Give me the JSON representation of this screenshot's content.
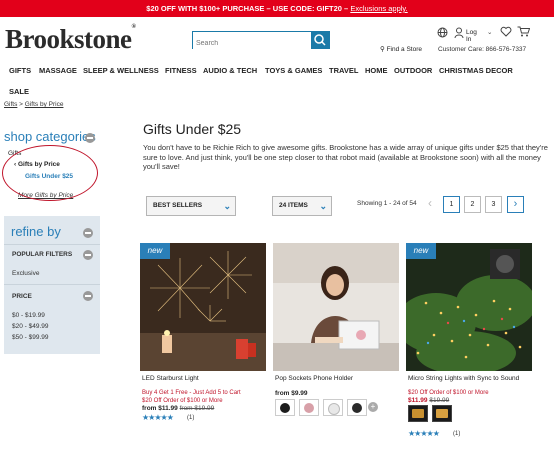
{
  "promo": {
    "text": "$20 OFF WITH $100+ PURCHASE – USE CODE: GIFT20 –",
    "link": "Exclusions apply."
  },
  "header": {
    "logo": "Brookstone",
    "search_placeholder": "Search",
    "login": "Log In",
    "find_store": "Find a Store",
    "customer_care": "Customer Care: 866-576-7337"
  },
  "nav": {
    "items": [
      "GIFTS",
      "MASSAGE",
      "SLEEP & WELLNESS",
      "FITNESS",
      "AUDIO & TECH",
      "TOYS & GAMES",
      "TRAVEL",
      "HOME",
      "OUTDOOR",
      "CHRISTMAS DECOR",
      "SALE"
    ]
  },
  "breadcrumb": {
    "home": "Gifts",
    "sep": " > ",
    "current": "Gifts by Price"
  },
  "sidebar": {
    "shop_categories": "shop categories",
    "cat_root": "Gifts",
    "cat_parent": "Gifts by Price",
    "cat_current": "Gifts Under $25",
    "more": "More Gifts by Price",
    "refine_by": "refine by",
    "popular_filters": "POPULAR FILTERS",
    "exclusive": "Exclusive",
    "price_label": "PRICE",
    "price_ranges": [
      "$0 - $19.99",
      "$20 - $49.99",
      "$50 - $99.99"
    ]
  },
  "main": {
    "title": "Gifts Under $25",
    "description": "You don't have to be Richie Rich to give awesome gifts. Brookstone has a wide array of unique gifts under $25 that they're sure to love. And just think, you'll be one step closer to that robot maid (available at Brookstone soon) with all the money you'll save!",
    "sort": "BEST SELLERS",
    "per_page": "24 ITEMS",
    "showing": "Showing 1 - 24 of 54",
    "pages": [
      "1",
      "2",
      "3"
    ]
  },
  "products": [
    {
      "badge": "new",
      "name": "LED Starburst Light",
      "promo1": "Buy 4 Get 1 Free - Just Add 5 to Cart",
      "promo2": "$20 Off Order of $100 or More",
      "price_from": "from $11.99",
      "price_was": "from $19.99",
      "stars": "★★★★★",
      "reviews": "(1)"
    },
    {
      "badge": "",
      "name": "Pop Sockets Phone Holder",
      "price_from": "from $9.99",
      "swatch_colors": [
        "#1c1c1c",
        "#d8a0a8",
        "#e8e8e8",
        "#2a2a2a"
      ]
    },
    {
      "badge": "new",
      "name": "Micro String Lights with Sync to Sound",
      "promo2": "$20 Off Order of $100 or More",
      "price_from": "$11.99",
      "price_was": "$19.99",
      "stars": "★★★★★",
      "reviews": "(1)"
    }
  ]
}
